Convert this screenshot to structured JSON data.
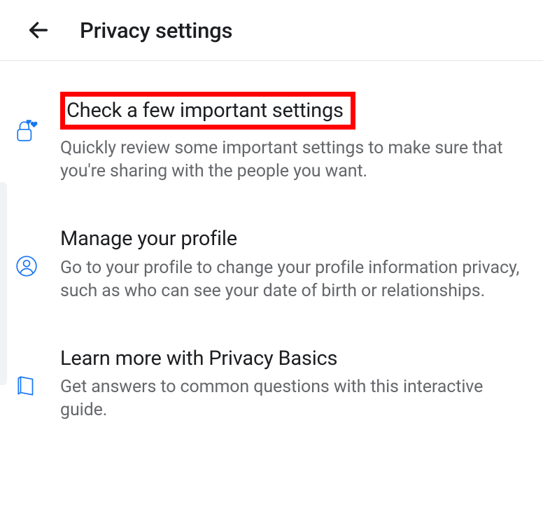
{
  "header": {
    "title": "Privacy settings"
  },
  "items": [
    {
      "icon": "lock-heart-icon",
      "title": "Check a few important settings",
      "desc": "Quickly review some important settings to make sure that you're sharing with the people you want.",
      "highlighted": true
    },
    {
      "icon": "person-circle-icon",
      "title": "Manage your profile",
      "desc": "Go to your profile to change your profile information privacy, such as who can see your date of birth or relationships.",
      "highlighted": false
    },
    {
      "icon": "book-icon",
      "title": "Learn more with Privacy Basics",
      "desc": "Get answers to common questions with this interactive guide.",
      "highlighted": false
    }
  ],
  "colors": {
    "icon": "#1877f2",
    "highlight": "#ff0000"
  }
}
